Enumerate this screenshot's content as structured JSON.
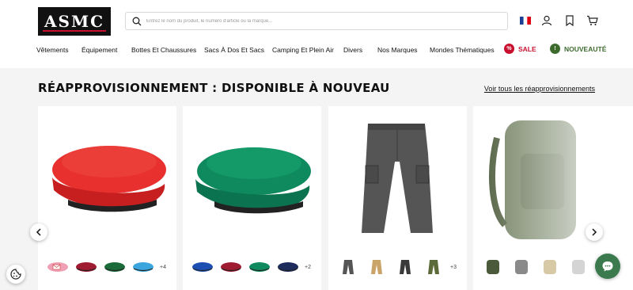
{
  "logo": {
    "text": "ASMC"
  },
  "search": {
    "placeholder": "Entrez le nom du produit, le numéro d'article ou la marque..."
  },
  "header_icons": [
    "flag-fr-icon",
    "user-icon",
    "bookmark-icon",
    "cart-icon"
  ],
  "nav": {
    "items": [
      {
        "label": "Vêtements"
      },
      {
        "label": "Équipement"
      },
      {
        "label": "Bottes Et Chaussures"
      },
      {
        "label": "Sacs À Dos Et Sacs"
      },
      {
        "label": "Camping Et Plein Air"
      },
      {
        "label": "Divers"
      },
      {
        "label": "Nos Marques"
      },
      {
        "label": "Mondes Thématiques"
      }
    ],
    "sale": {
      "label": "SALE",
      "icon": "%",
      "color": "#c8102e"
    },
    "new": {
      "label": "NOUVEAUTÉ",
      "icon": "!",
      "color": "#3d6b2e"
    }
  },
  "section": {
    "title": "RÉAPPROVISIONNEMENT : DISPONIBLE À NOUVEAU",
    "see_all": "Voir tous les réapprovisionnements"
  },
  "products": [
    {
      "name": "red-beret",
      "color": "#e8302e",
      "swatches": [
        "#f0a0b4",
        "#9e1b32",
        "#1b6b3a",
        "#3aa6dd"
      ],
      "more": "+4"
    },
    {
      "name": "green-beret",
      "color": "#0f8a5f",
      "swatches": [
        "#1d4fb3",
        "#9e1b32",
        "#0f8a5f",
        "#1d2a5c"
      ],
      "more": "+2"
    },
    {
      "name": "cargo-pants",
      "color": "#555",
      "swatches": [
        "#555555",
        "#c9a56a",
        "#3a3a3a",
        "#5b6b3a"
      ],
      "more": "+3"
    },
    {
      "name": "backpack",
      "color": "#6b7a5a",
      "swatches": [
        "#4b5a3a",
        "#8a8a8a",
        "#d8c9a6",
        "#c8c8c8"
      ],
      "more": ""
    }
  ]
}
